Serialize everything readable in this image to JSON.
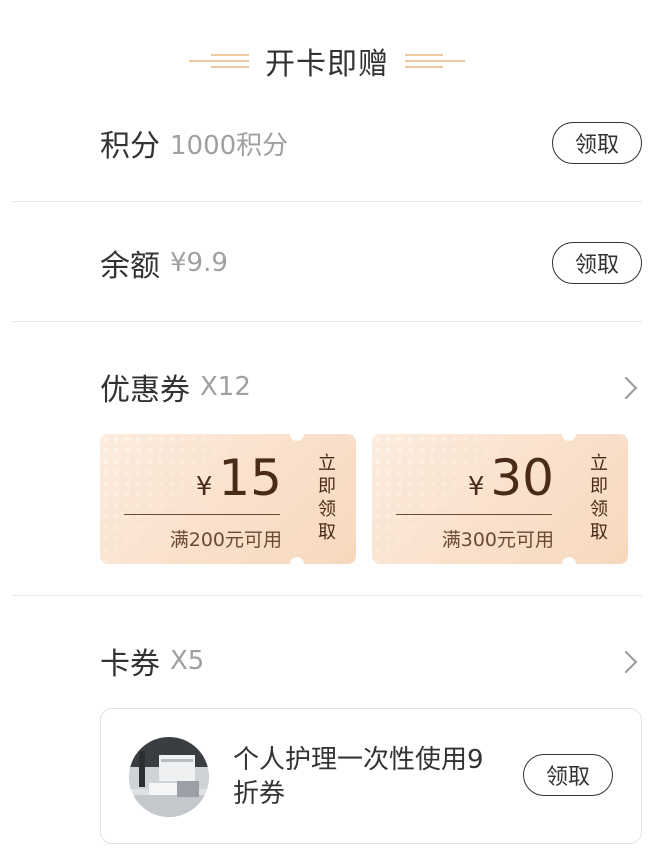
{
  "header": {
    "title": "开卡即赠"
  },
  "points": {
    "label": "积分",
    "value": "1000积分",
    "button": "领取"
  },
  "balance": {
    "label": "余额",
    "value": "¥9.9",
    "button": "领取"
  },
  "coupons_section": {
    "label": "优惠券",
    "count": "X12",
    "items": [
      {
        "currency": "¥",
        "amount": "15",
        "condition": "满200元可用",
        "action": "立即领取"
      },
      {
        "currency": "¥",
        "amount": "30",
        "condition": "满300元可用",
        "action": "立即领取"
      }
    ]
  },
  "cards_section": {
    "label": "卡券",
    "count": "X5",
    "items": [
      {
        "title": "个人护理一次性使用9折券",
        "button": "领取"
      }
    ]
  },
  "colors": {
    "coupon_bg_start": "#fcebdd",
    "coupon_bg_end": "#f7d8bd",
    "coupon_text": "#4a2a18",
    "accent_line": "#f1c89c",
    "muted_text": "#a0a0a0"
  }
}
